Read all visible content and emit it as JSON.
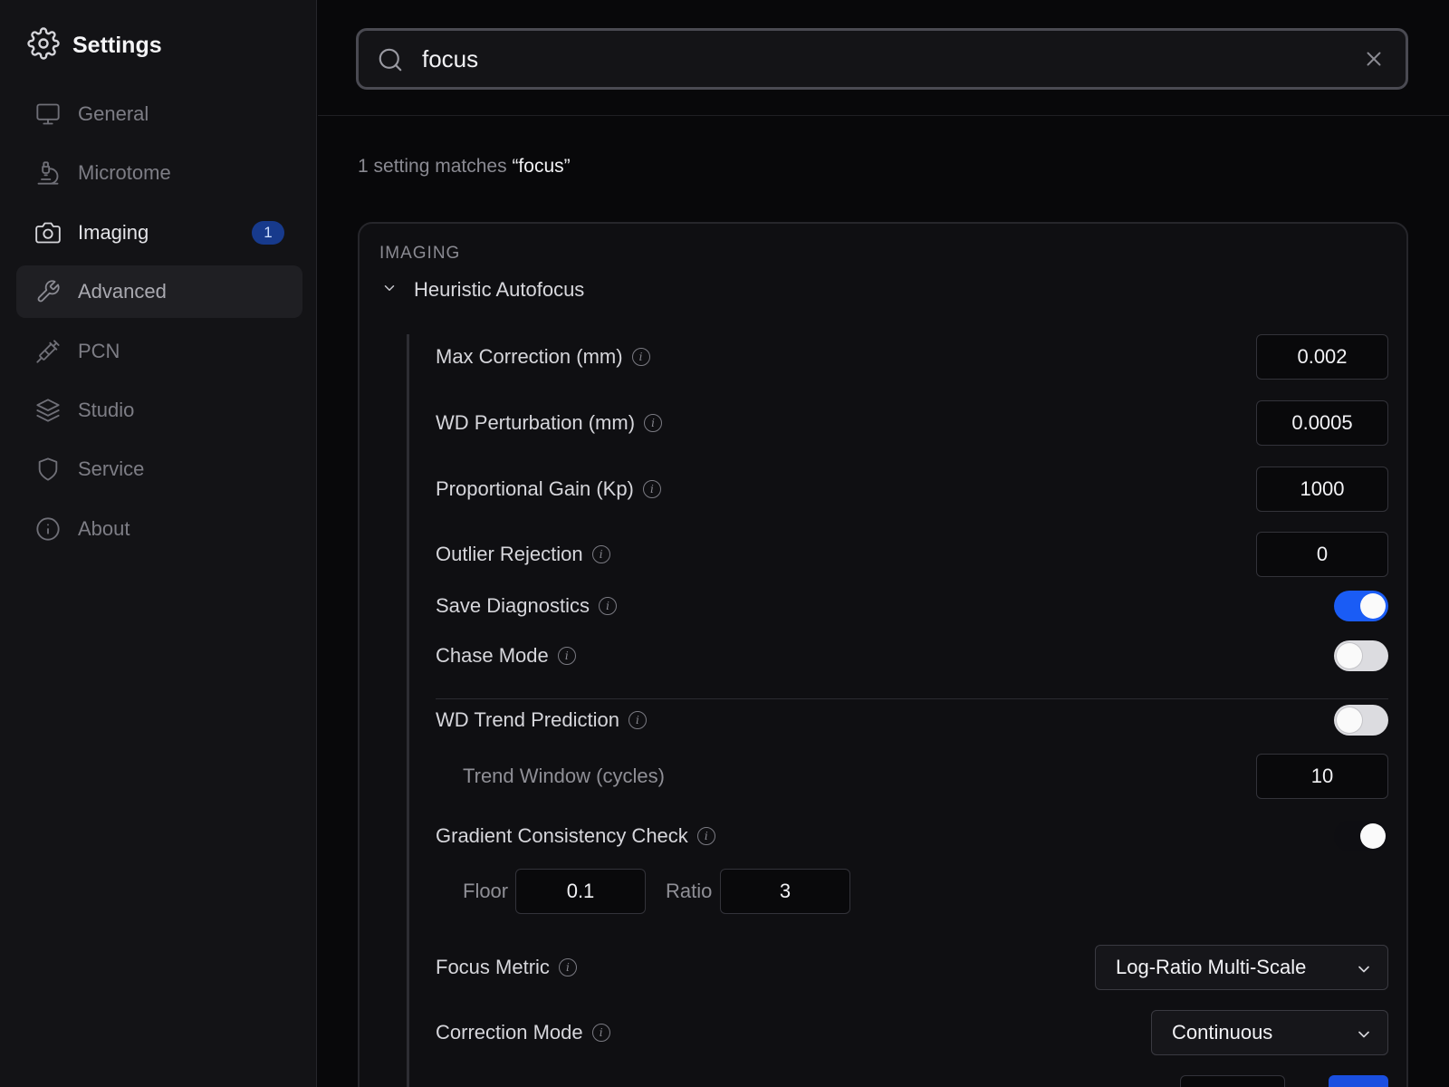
{
  "sidebar": {
    "title": "Settings",
    "items": [
      {
        "label": "General",
        "icon": "monitor-icon"
      },
      {
        "label": "Microtome",
        "icon": "microscope-icon"
      },
      {
        "label": "Imaging",
        "icon": "camera-icon",
        "badge": "1"
      },
      {
        "label": "Advanced",
        "icon": "wrench-icon"
      },
      {
        "label": "PCN",
        "icon": "syringe-icon"
      },
      {
        "label": "Studio",
        "icon": "layers-icon"
      },
      {
        "label": "Service",
        "icon": "shield-icon"
      },
      {
        "label": "About",
        "icon": "info-icon"
      }
    ]
  },
  "search": {
    "value": "focus",
    "placeholder": ""
  },
  "results": {
    "summary_prefix": "1 setting matches",
    "summary_query": "“focus”"
  },
  "section": {
    "label": "IMAGING",
    "group_title": "Heuristic Autofocus"
  },
  "settings": {
    "max_correction": {
      "label": "Max Correction (mm)",
      "value": "0.002"
    },
    "wd_perturbation": {
      "label": "WD Perturbation (mm)",
      "value": "0.0005"
    },
    "proportional_gain": {
      "label": "Proportional Gain (Kp)",
      "value": "1000"
    },
    "outlier_rejection": {
      "label": "Outlier Rejection",
      "value": "0"
    },
    "save_diagnostics": {
      "label": "Save Diagnostics",
      "on": true
    },
    "chase_mode": {
      "label": "Chase Mode",
      "on": false
    },
    "wd_trend_prediction": {
      "label": "WD Trend Prediction",
      "on": false
    },
    "trend_window": {
      "label": "Trend Window (cycles)",
      "value": "10"
    },
    "gradient_consistency": {
      "label": "Gradient Consistency Check",
      "on": true
    },
    "floor": {
      "label": "Floor",
      "value": "0.1"
    },
    "ratio": {
      "label": "Ratio",
      "value": "3"
    },
    "focus_metric": {
      "label": "Focus Metric",
      "value": "Log-Ratio Multi-Scale"
    },
    "correction_mode": {
      "label": "Correction Mode",
      "value": "Continuous"
    }
  },
  "colors": {
    "accent": "#1a5cf5",
    "badge_bg": "#173a8c",
    "background": "#08080a",
    "sidebar_bg": "#131316"
  }
}
